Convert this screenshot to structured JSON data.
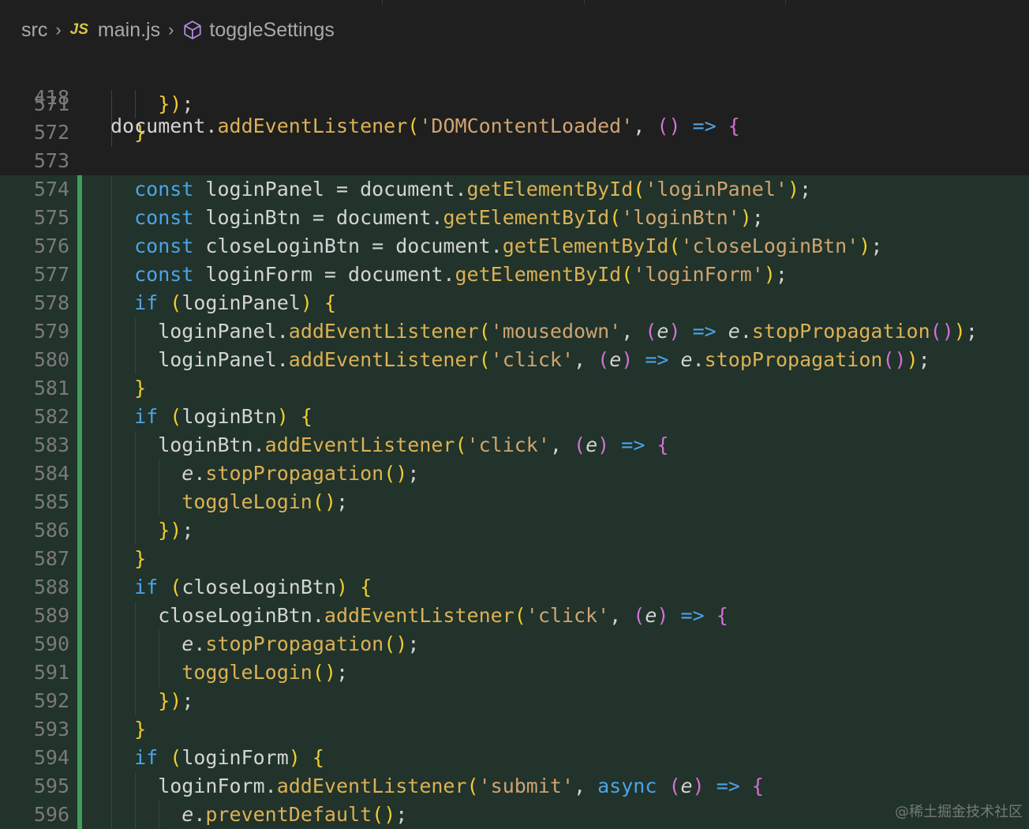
{
  "breadcrumb": {
    "folder": "src",
    "file_badge": "JS",
    "file": "main.js",
    "symbol": "toggleSettings"
  },
  "sticky_line": {
    "number": "418",
    "code": "document.addEventListener('DOMContentLoaded', () => {"
  },
  "lines": [
    {
      "n": "571",
      "code": "    });"
    },
    {
      "n": "572",
      "code": "  }"
    },
    {
      "n": "573",
      "code": ""
    },
    {
      "n": "574",
      "code": "  const loginPanel = document.getElementById('loginPanel');"
    },
    {
      "n": "575",
      "code": "  const loginBtn = document.getElementById('loginBtn');"
    },
    {
      "n": "576",
      "code": "  const closeLoginBtn = document.getElementById('closeLoginBtn');"
    },
    {
      "n": "577",
      "code": "  const loginForm = document.getElementById('loginForm');"
    },
    {
      "n": "578",
      "code": "  if (loginPanel) {"
    },
    {
      "n": "579",
      "code": "    loginPanel.addEventListener('mousedown', (e) => e.stopPropagation());"
    },
    {
      "n": "580",
      "code": "    loginPanel.addEventListener('click', (e) => e.stopPropagation());"
    },
    {
      "n": "581",
      "code": "  }"
    },
    {
      "n": "582",
      "code": "  if (loginBtn) {"
    },
    {
      "n": "583",
      "code": "    loginBtn.addEventListener('click', (e) => {"
    },
    {
      "n": "584",
      "code": "      e.stopPropagation();"
    },
    {
      "n": "585",
      "code": "      toggleLogin();"
    },
    {
      "n": "586",
      "code": "    });"
    },
    {
      "n": "587",
      "code": "  }"
    },
    {
      "n": "588",
      "code": "  if (closeLoginBtn) {"
    },
    {
      "n": "589",
      "code": "    closeLoginBtn.addEventListener('click', (e) => {"
    },
    {
      "n": "590",
      "code": "      e.stopPropagation();"
    },
    {
      "n": "591",
      "code": "      toggleLogin();"
    },
    {
      "n": "592",
      "code": "    });"
    },
    {
      "n": "593",
      "code": "  }"
    },
    {
      "n": "594",
      "code": "  if (loginForm) {"
    },
    {
      "n": "595",
      "code": "    loginForm.addEventListener('submit', async (e) => {"
    },
    {
      "n": "596",
      "code": "      e.preventDefault();"
    }
  ],
  "watermark": "@稀土掘金技术社区",
  "colors": {
    "background": "#1f1f1f",
    "added_line_background": "#21332a",
    "added_gutter_marker": "#3e9c5b",
    "keyword": "#4ca3e8",
    "function": "#dcb155",
    "string": "#cfa472"
  }
}
